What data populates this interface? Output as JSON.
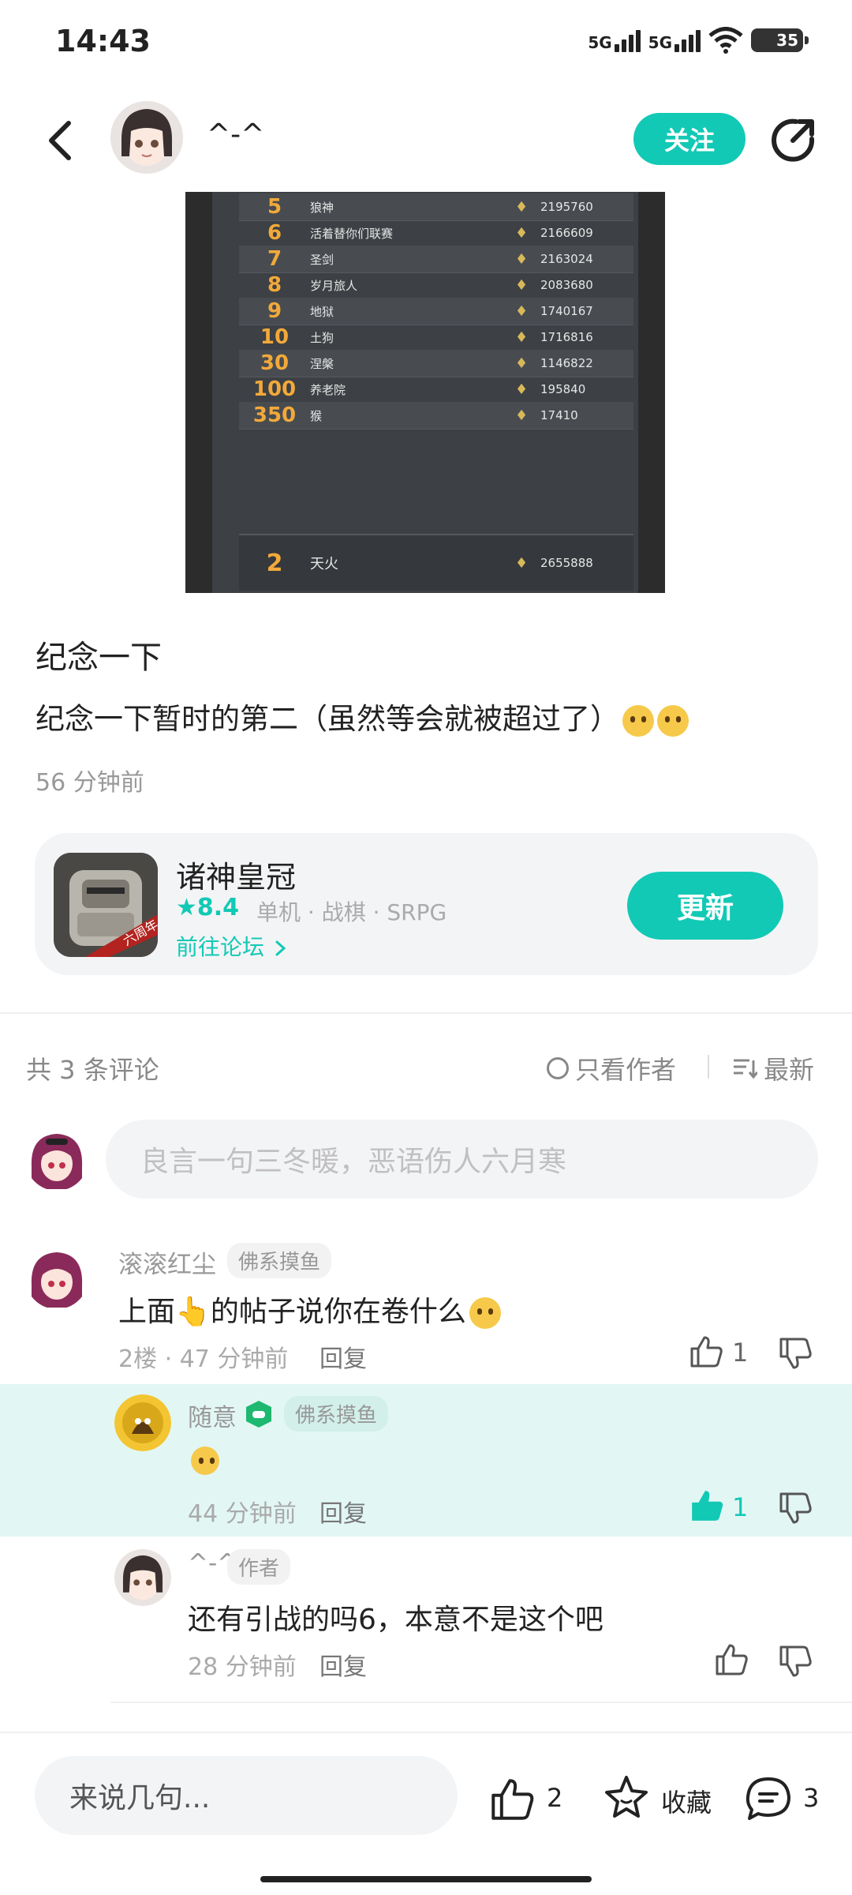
{
  "status_bar": {
    "time": "14:43",
    "signal1": "5G",
    "signal2": "5G",
    "battery": "35"
  },
  "header": {
    "author_name": "^-^",
    "follow_label": "关注"
  },
  "leaderboard": {
    "rows": [
      {
        "rank": "5",
        "name": "狼神",
        "score": "2195760"
      },
      {
        "rank": "6",
        "name": "活着替你们联赛",
        "score": "2166609"
      },
      {
        "rank": "7",
        "name": "圣剑",
        "score": "2163024"
      },
      {
        "rank": "8",
        "name": "岁月旅人",
        "score": "2083680"
      },
      {
        "rank": "9",
        "name": "地狱",
        "score": "1740167"
      },
      {
        "rank": "10",
        "name": "土狗",
        "score": "1716816"
      },
      {
        "rank": "30",
        "name": "涅槃",
        "score": "1146822"
      },
      {
        "rank": "100",
        "name": "养老院",
        "score": "195840"
      },
      {
        "rank": "350",
        "name": "猴",
        "score": "17410"
      }
    ],
    "self": {
      "rank": "2",
      "name": "天火",
      "score": "2655888"
    }
  },
  "post": {
    "title": "纪念一下",
    "body": "纪念一下暂时的第二（虽然等会就被超过了）",
    "time": "56 分钟前"
  },
  "game_card": {
    "name": "诸神皇冠",
    "rating": "8.4",
    "tags": "单机 · 战棋 · SRPG",
    "forum_link": "前往论坛",
    "update_label": "更新",
    "icon_ribbon": "六周年"
  },
  "comments_header": {
    "count_label": "共 3 条评论",
    "only_author": "只看作者",
    "sort_label": "最新"
  },
  "comment_input": {
    "placeholder": "良言一句三冬暖，恶语伤人六月寒"
  },
  "comments": [
    {
      "user": "滚滚红尘",
      "badge": "佛系摸鱼",
      "text_before": "上面",
      "text_after": "的帖子说你在卷什么",
      "meta": "2楼 · 47 分钟前",
      "reply_label": "回复",
      "likes": "1"
    },
    {
      "user": "随意",
      "badge": "佛系摸鱼",
      "meta": "44 分钟前",
      "reply_label": "回复",
      "likes": "1"
    },
    {
      "user": "^-^",
      "badge": "作者",
      "text": "还有引战的吗6，本意不是这个吧",
      "meta": "28 分钟前",
      "reply_label": "回复"
    }
  ],
  "bottom_bar": {
    "input_placeholder": "来说几句...",
    "likes": "2",
    "collect_label": "收藏",
    "comments": "3"
  },
  "colors": {
    "accent": "#12c9b5",
    "highlight": "#e2f7f4"
  }
}
